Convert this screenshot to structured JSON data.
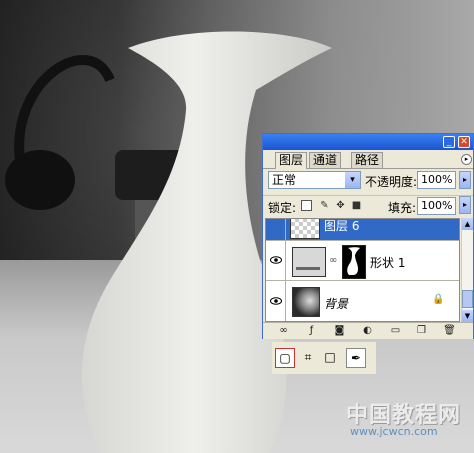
{
  "window": {
    "minimize_glyph": "_",
    "close_glyph": "✕"
  },
  "tabs": [
    {
      "label": "图层",
      "active": true
    },
    {
      "label": "通道",
      "active": false
    },
    {
      "label": "路径",
      "active": false
    }
  ],
  "panel_menu_glyph": "▸",
  "blend": {
    "mode": "正常",
    "dropdown_glyph": "▾"
  },
  "opacity": {
    "label": "不透明度:",
    "value": "100%"
  },
  "lock": {
    "label": "锁定:"
  },
  "fill": {
    "label": "填充:",
    "value": "100%"
  },
  "layers": [
    {
      "name": "图层 6",
      "selected": true
    },
    {
      "name": "形状 1",
      "selected": false
    },
    {
      "name": "背景",
      "selected": false,
      "locked": true
    }
  ],
  "icons": {
    "eye": "eye-icon",
    "lock": "lock-icon",
    "chain": "link-icon"
  },
  "bottom_bar": [
    "link-layers-icon",
    "layer-style-icon",
    "add-mask-icon",
    "adjustment-layer-icon",
    "new-group-icon",
    "new-layer-icon",
    "delete-layer-icon"
  ],
  "options": [
    "shape-layers-mode",
    "paths-mode",
    "fill-pixels-mode",
    "pen-tool"
  ],
  "watermark": {
    "cn": "中国教程网",
    "url": "www.jcwcn.com"
  },
  "colors": {
    "title_bar": "#1a55cf",
    "selection": "#3169c6",
    "panel_bg": "#ece9d8",
    "close": "#d8492a"
  }
}
